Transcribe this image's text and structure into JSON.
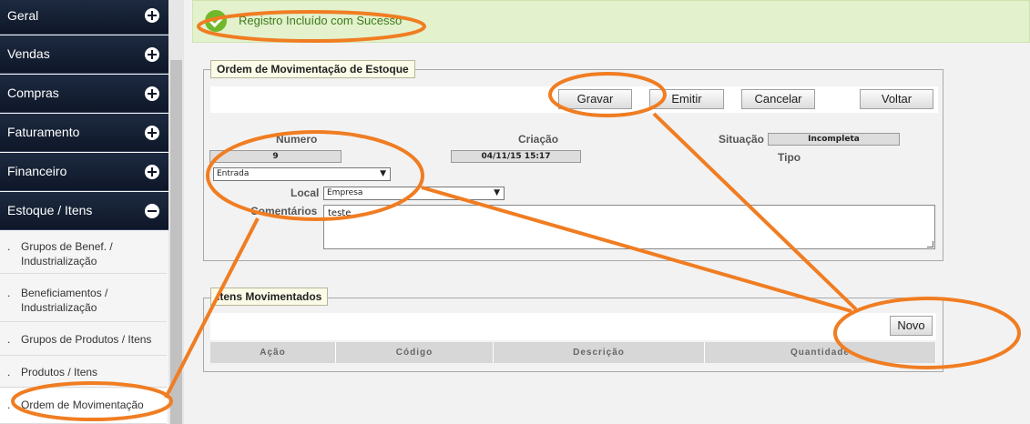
{
  "sidebar": {
    "menus": [
      {
        "label": "Geral"
      },
      {
        "label": "Vendas"
      },
      {
        "label": "Compras"
      },
      {
        "label": "Faturamento"
      },
      {
        "label": "Financeiro"
      },
      {
        "label": "Estoque / Itens"
      }
    ],
    "sub_items": [
      {
        "line1": "Grupos de Benef. /",
        "line2": "Industrialização"
      },
      {
        "line1": "Beneficiamentos /",
        "line2": "Industrialização"
      },
      {
        "line1": "Grupos de Produtos / Itens",
        "line2": ""
      },
      {
        "line1": "Produtos / Itens",
        "line2": ""
      },
      {
        "line1": "Ordem de Movimentação",
        "line2": ""
      }
    ],
    "bullet": "."
  },
  "banner": {
    "message": "Registro Incluído com Sucesso"
  },
  "order": {
    "legend": "Ordem de Movimentação de Estoque",
    "buttons": {
      "save": "Gravar",
      "issue": "Emitir",
      "cancel": "Cancelar",
      "back": "Voltar"
    },
    "numero_label": "Numero",
    "numero_value": "9",
    "criacao_label": "Criação",
    "criacao_value": "04/11/15 15:17",
    "situacao_label": "Situação",
    "situacao_value": "Incompleta",
    "tipo_label": "Tipo",
    "tipo_value": "Entrada",
    "local_label": "Local",
    "local_value": "Empresa",
    "comentarios_label": "Comentários",
    "comentarios_value": "teste"
  },
  "items": {
    "legend": "Itens Movimentados",
    "new_button": "Novo",
    "columns": [
      "Ação",
      "Código",
      "Descrição",
      "Quantidade"
    ]
  },
  "icons": {
    "expand": "plus-circle-icon",
    "collapse": "minus-circle-icon",
    "success": "check-circle-icon",
    "dropdown": "caret-down-icon"
  },
  "colors": {
    "sidebar_bg": "#0e1728",
    "banner_bg": "#e3f1cd",
    "annotation": "#f07d22",
    "success": "#6fb82b"
  },
  "caret": "▼"
}
